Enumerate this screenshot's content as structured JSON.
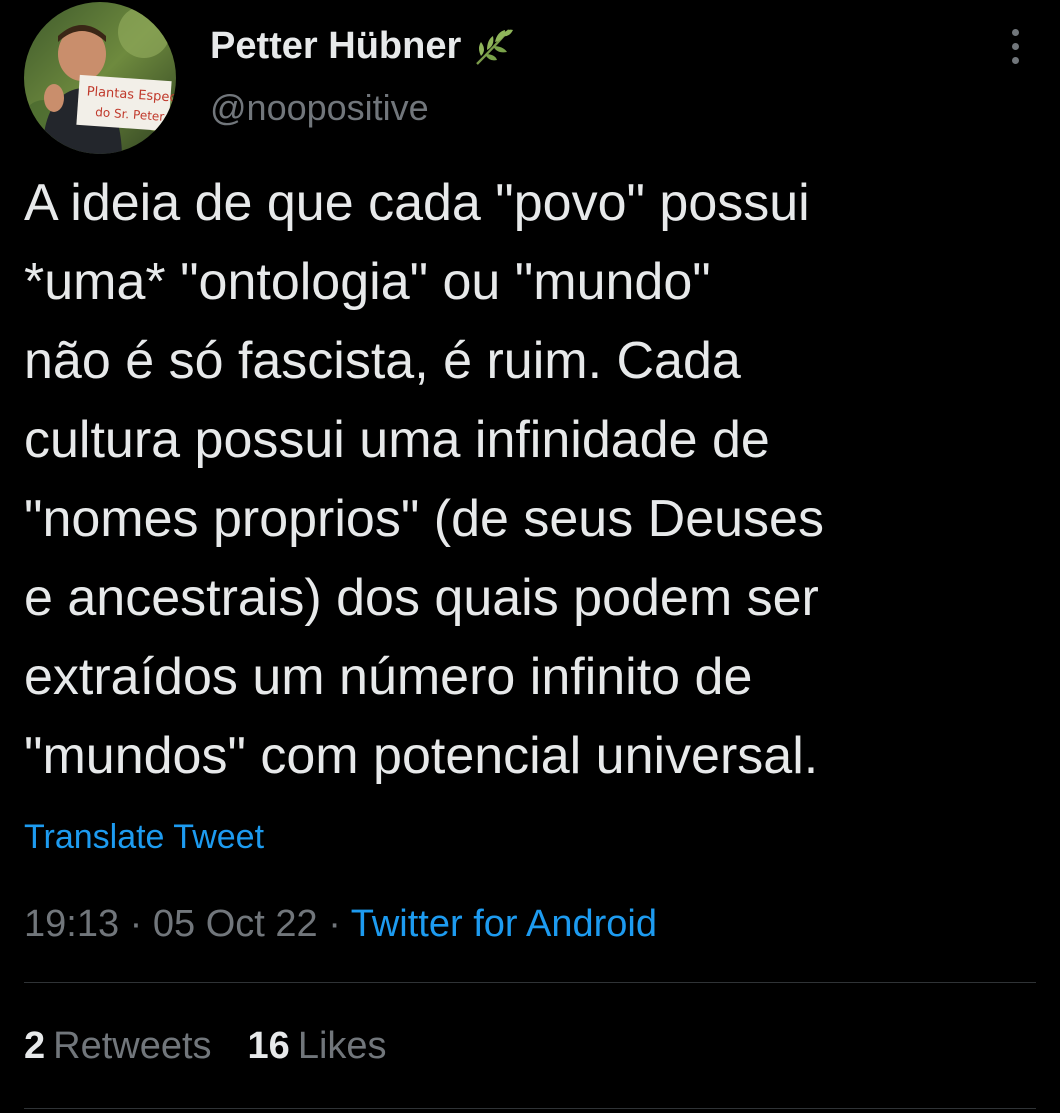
{
  "author": {
    "name": "Petter Hübner",
    "handle": "@noopositive",
    "avatar_sign_text": [
      "Plantas Especiais",
      "do Sr. Peter"
    ]
  },
  "tweet": {
    "text_lines": [
      "A ideia de que cada \"povo\" possui",
      "*uma* \"ontologia\" ou \"mundo\"",
      "não é só fascista, é ruim. Cada",
      "cultura possui uma infinidade de",
      "\"nomes proprios\" (de seus Deuses",
      "e ancestrais) dos quais podem ser",
      "extraídos um número infinito de",
      "\"mundos\" com potencial universal."
    ],
    "translate_label": "Translate Tweet",
    "time": "19:13",
    "separator": "·",
    "date": "05 Oct 22",
    "source": "Twitter for Android"
  },
  "stats": {
    "retweets_count": "2",
    "retweets_label": "Retweets",
    "likes_count": "16",
    "likes_label": "Likes"
  },
  "icons": {
    "more": "more-vertical-icon",
    "name_emoji": "herb-icon"
  },
  "colors": {
    "background": "#000000",
    "text": "#e7e9ea",
    "secondary": "#71767b",
    "link": "#1d9bf0",
    "divider": "#2f3336"
  }
}
